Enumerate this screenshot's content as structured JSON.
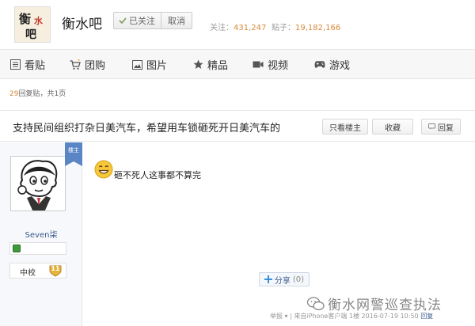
{
  "forum": {
    "logo_chars": [
      "衡",
      "水",
      "吧"
    ],
    "name": "衡水吧",
    "followed_label": "已关注",
    "cancel_label": "取消",
    "followers_label": "关注：",
    "followers_count": "431,247",
    "posts_label": "贴子：",
    "posts_count": "19,182,166"
  },
  "nav": {
    "items": [
      {
        "label": "看贴",
        "icon": "post-list-icon"
      },
      {
        "label": "团购",
        "icon": "shopping-cart-icon"
      },
      {
        "label": "图片",
        "icon": "picture-icon"
      },
      {
        "label": "精品",
        "icon": "star-icon"
      },
      {
        "label": "视频",
        "icon": "video-camera-icon"
      },
      {
        "label": "游戏",
        "icon": "gamepad-icon"
      }
    ]
  },
  "thread_meta": {
    "reply_count": "29",
    "reply_suffix": "回复贴，共1页"
  },
  "thread": {
    "title": "支持民间组织打杂日美汽车，希望用车锁砸死开日美汽车的",
    "only_op_label": "只看楼主",
    "favorite_label": "收藏",
    "reply_label": "回复"
  },
  "post": {
    "op_badge": "楼主",
    "username": "Seven柒",
    "level_name": "中校",
    "level_number": "11",
    "text": "砸不死人这事都不算完",
    "share_label": "分享",
    "share_count": "(0)",
    "report_label": "举报",
    "source": "来自iPhone客户端",
    "floor": "1楼",
    "timestamp": "2016-07-19 10:50",
    "reply_label": "回复"
  },
  "watermark": {
    "text": "衡水网警巡查执法"
  },
  "colors": {
    "accent_orange": "#d88a3a",
    "link_blue": "#3a5a8c",
    "badge_blue": "#5b86c5"
  }
}
